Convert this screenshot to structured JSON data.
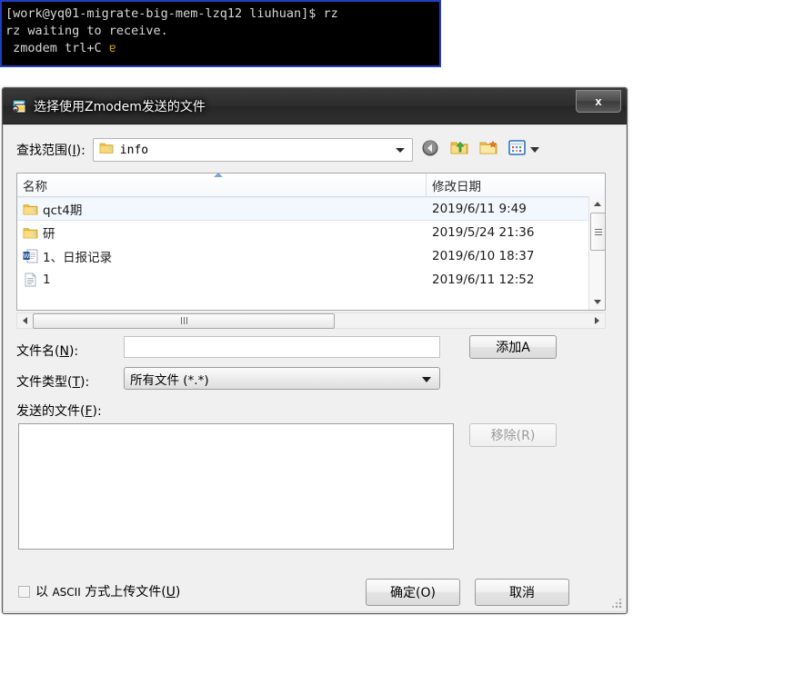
{
  "terminal": {
    "line1": "[work@yq01-migrate-big-mem-lzq12 liuhuan]$ rz",
    "line2": "rz waiting to receive.",
    "line3": " zmodem trl+C ",
    "cursor": "ɐ"
  },
  "dialog": {
    "title": "选择使用Zmodem发送的文件",
    "title_icon": "secure-transfer-icon",
    "close_label": "x",
    "lookin": {
      "label": "查找范围(I):",
      "label_plain": "查找范围",
      "accel": "I",
      "value": "info",
      "folder_icon": "folder-icon",
      "back_icon": "back-arrow-icon",
      "up_icon": "up-one-level-icon",
      "newfolder_icon": "new-folder-icon",
      "views_icon": "views-icon"
    },
    "list": {
      "columns": [
        "名称",
        "修改日期"
      ],
      "rows": [
        {
          "name": "qct4期",
          "date": "2019/6/11 9:49",
          "icon": "folder-icon",
          "selected": true
        },
        {
          "name": "研",
          "date": "2019/5/24 21:36",
          "icon": "folder-icon",
          "selected": false
        },
        {
          "name": "1、日报记录",
          "date": "2019/6/10 18:37",
          "icon": "word-document-icon",
          "selected": false
        },
        {
          "name": "1",
          "date": "2019/6/11 12:52",
          "icon": "text-file-icon",
          "selected": false
        }
      ]
    },
    "filename": {
      "label": "文件名(N):",
      "value": "",
      "placeholder": ""
    },
    "filetype": {
      "label": "文件类型(T):",
      "value": "所有文件 (*.*)"
    },
    "sendfiles": {
      "label": "发送的文件(F):",
      "value": ""
    },
    "buttons": {
      "add": "添加A",
      "remove": "移除(R)",
      "ok": "确定(O)",
      "cancel": "取消"
    },
    "ascii_option": {
      "label_pre": "以 ",
      "label_mid": "ASCII",
      "label_post": " 方式上传文件(U)",
      "checked": false
    }
  },
  "colors": {
    "dialog_bg": "#f0f0f0",
    "titlebar": "#2d2d2d",
    "selection": "#f2f8fd",
    "folder": "#f5ce6a",
    "terminal_bg": "#000000",
    "terminal_border": "#1f3fbf"
  }
}
